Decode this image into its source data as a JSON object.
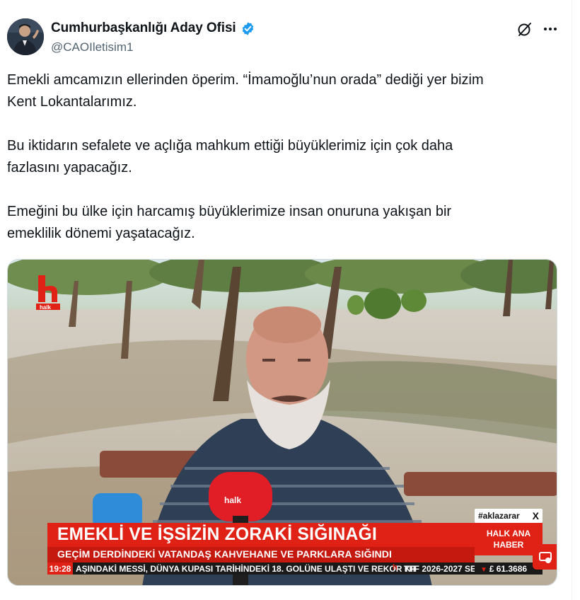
{
  "author": {
    "display_name": "Cumhurbaşkanlığı Aday Ofisi",
    "handle": "@CAOIletisim1",
    "verified": true,
    "verified_color": "#1d9bf0"
  },
  "header_icons": [
    "grok-icon",
    "more-icon"
  ],
  "tweet": {
    "paragraphs": [
      [
        "Emekli amcamızın ellerinden öperim. “İmamoğlu’nun orada” dediği yer bizim",
        "Kent Lokantalarımız."
      ],
      [
        "Bu iktidarın sefalete ve açlığa mahkum ettiği büyüklerimiz için çok daha",
        "fazlasını yapacağız."
      ],
      [
        "Emeğini bu ülke için harcamış büyüklerimize insan onuruna yakışan bir",
        "emeklilik dönemi yaşatacağız."
      ]
    ]
  },
  "video": {
    "channel_logo": "halk",
    "hashtag": "#aklazarar",
    "hashtag_close": "X",
    "headline": "EMEKLİ VE İŞSİZİN ZORAKİ SIĞINAĞI",
    "subheadline": "GEÇİM DERDİNDEKİ VATANDAŞ KAHVEHANE VE PARKLARA SIĞINDI",
    "program_line1": "HALK ANA",
    "program_line2": "HABER",
    "ticker_time": "19:28",
    "ticker_text": "AŞINDAKİ MESSİ, DÜNYA KUPASI TARİHİNDEKİ 18. GOLÜNE ULAŞTI VE REKOR KIRDI",
    "ticker_logo": "h",
    "ticker_text2": "TFF 2026-2027 SE",
    "ticker_rate": "£ 61.3686",
    "mic_label": "halk",
    "accent_color": "#e02216"
  }
}
